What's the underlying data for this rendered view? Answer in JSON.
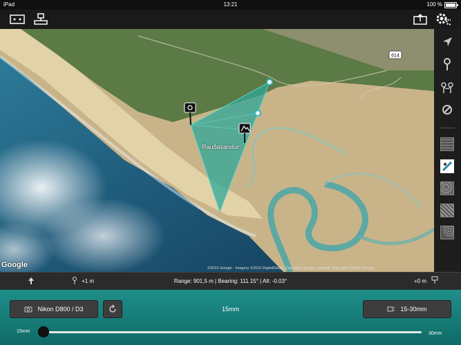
{
  "status": {
    "device": "iPad",
    "time": "13:21",
    "battery": "100 %"
  },
  "map": {
    "place_label": "Rauðasandur",
    "google_logo": "Google",
    "copyright": "©2015 Google - Imagery ©2015 DigitalGlobe, Cnes/Spot Image, Landsat, Map data ©2015 Google",
    "road_sign": "614"
  },
  "info": {
    "camera_height": "+1 m",
    "readout": "Range: 901,5 m | Bearing: 111.15° | Alt: -0.03°",
    "target_height": "+0 m"
  },
  "controls": {
    "camera": "Nikon D800 / D3",
    "focal": "15mm",
    "lens": "15-30mm",
    "slider_min": "15mm",
    "slider_max": "30mm",
    "slider_value_fraction": 0
  },
  "icons": {
    "toolbar_left": [
      "photo-frame-icon",
      "survey-icon"
    ],
    "toolbar_right": [
      "share-icon",
      "settings-icon"
    ],
    "sidebar": [
      "locate-icon",
      "pin-icon",
      "pins-icon",
      "no-entry-icon",
      "map-grid-icon",
      "satellite-icon",
      "terrain-icon",
      "hatched-icon",
      "contour-icon"
    ]
  },
  "colors": {
    "accent": "#1b8a85",
    "wedge": "#2ea79a"
  }
}
